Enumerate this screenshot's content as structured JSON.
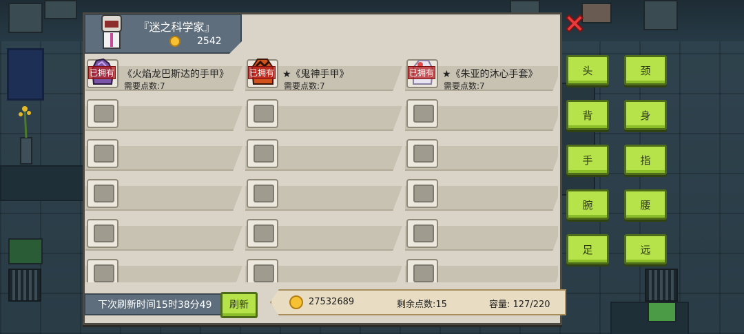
{
  "profile": {
    "name": "『迷之科学家』",
    "coins": "2542"
  },
  "items": [
    {
      "title": "《火焰龙巴斯达的手甲》",
      "cost": "需要点数:7",
      "owned": "已拥有",
      "art_color": "#7a55a8"
    },
    {
      "title": "★《鬼神手甲》",
      "cost": "需要点数:7",
      "owned": "已拥有",
      "art_color": "#d2531c"
    },
    {
      "title": "★《朱亚的沐心手套》",
      "cost": "需要点数:7",
      "owned": "已拥有",
      "art_color": "#e9e4f1"
    }
  ],
  "categories": [
    "头",
    "颈",
    "背",
    "身",
    "手",
    "指",
    "腕",
    "腰",
    "足",
    "远"
  ],
  "footer": {
    "refresh_time": "下次刷新时间15时38分49",
    "refresh_button": "刷新",
    "money": "27532689",
    "points_left": "剩余点数:15",
    "capacity": "容量:  127/220"
  },
  "colors": {
    "accent_green": "#b6e34a",
    "panel": "#d9d4c7",
    "header": "#5e6e7c",
    "close": "#e83b3b"
  }
}
